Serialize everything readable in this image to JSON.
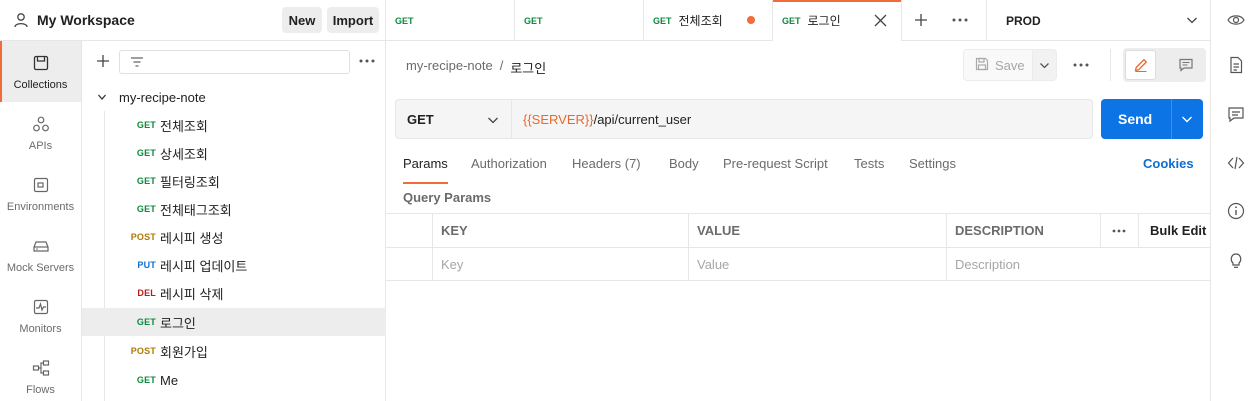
{
  "workspace": {
    "title": "My Workspace",
    "new_label": "New",
    "import_label": "Import"
  },
  "leftnav": [
    {
      "label": "Collections",
      "icon": "collections-icon",
      "active": true
    },
    {
      "label": "APIs",
      "icon": "apis-icon"
    },
    {
      "label": "Environments",
      "icon": "environments-icon"
    },
    {
      "label": "Mock Servers",
      "icon": "mock-servers-icon"
    },
    {
      "label": "Monitors",
      "icon": "monitors-icon"
    },
    {
      "label": "Flows",
      "icon": "flows-icon"
    }
  ],
  "collection": {
    "name": "my-recipe-note",
    "requests": [
      {
        "method": "GET",
        "name": "전체조회"
      },
      {
        "method": "GET",
        "name": "상세조회"
      },
      {
        "method": "GET",
        "name": "필터링조회"
      },
      {
        "method": "GET",
        "name": "전체태그조회"
      },
      {
        "method": "POST",
        "name": "레시피 생성"
      },
      {
        "method": "PUT",
        "name": "레시피 업데이트"
      },
      {
        "method": "DEL",
        "name": "레시피 삭제"
      },
      {
        "method": "GET",
        "name": "로그인",
        "active": true
      },
      {
        "method": "POST",
        "name": "회원가입"
      },
      {
        "method": "GET",
        "name": "Me"
      }
    ]
  },
  "tabs": [
    {
      "method": "GET",
      "name": ""
    },
    {
      "method": "GET",
      "name": ""
    },
    {
      "method": "GET",
      "name": "전체조회",
      "unsaved": true
    },
    {
      "method": "GET",
      "name": "로그인",
      "active": true
    }
  ],
  "environment": {
    "selected": "PROD"
  },
  "breadcrumb": {
    "collection": "my-recipe-note",
    "separator": "/",
    "request": "로그인"
  },
  "toolbar": {
    "save_label": "Save"
  },
  "request": {
    "method": "GET",
    "url_variable": "{{SERVER}}",
    "url_path": "/api/current_user",
    "send_label": "Send"
  },
  "subtabs": [
    {
      "label": "Params",
      "active": true
    },
    {
      "label": "Authorization"
    },
    {
      "label": "Headers (7)"
    },
    {
      "label": "Body"
    },
    {
      "label": "Pre-request Script"
    },
    {
      "label": "Tests"
    },
    {
      "label": "Settings"
    }
  ],
  "cookies_label": "Cookies",
  "query_params": {
    "title": "Query Params",
    "headers": {
      "key": "KEY",
      "value": "VALUE",
      "description": "DESCRIPTION",
      "bulk_edit": "Bulk Edit"
    },
    "placeholders": {
      "key": "Key",
      "value": "Value",
      "description": "Description"
    }
  },
  "colors": {
    "accent": "#f26b3a",
    "send": "#0d74e6",
    "get": "#0b8a3e",
    "post": "#ad7a03",
    "put": "#0d6fd0",
    "del": "#b91c1c"
  }
}
